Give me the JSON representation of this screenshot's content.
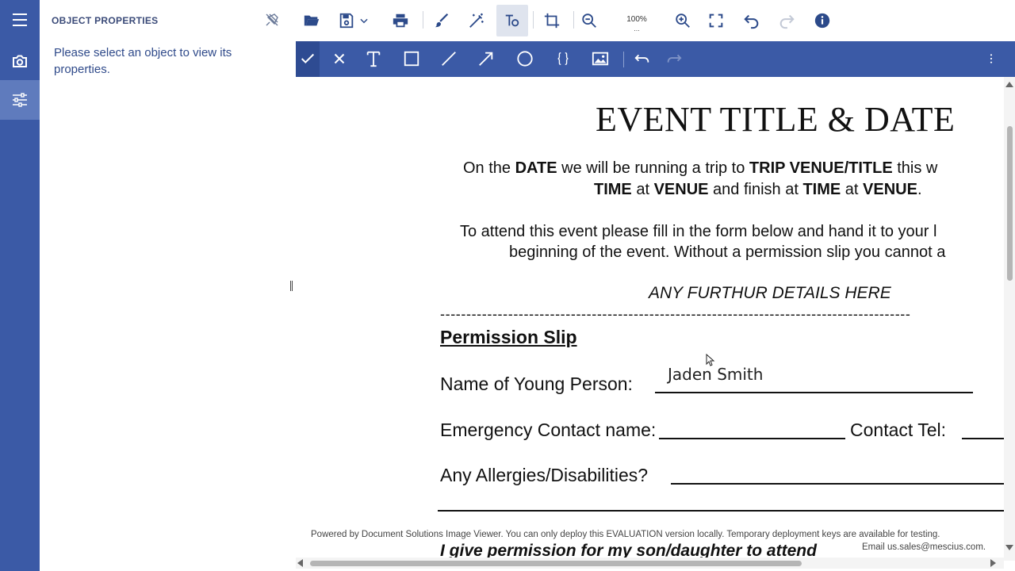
{
  "panel": {
    "title": "OBJECT PROPERTIES",
    "message": "Please select an object to view its properties."
  },
  "toolbar": {
    "zoom_value": "100%",
    "zoom_menu": "...",
    "accent_color": "#3b5aa6",
    "icons": [
      "folder-open-icon",
      "save-icon",
      "chevron-down-icon",
      "print-icon",
      "brush-icon",
      "magic-wand-icon",
      "text-tool-icon",
      "crop-icon",
      "zoom-out-icon",
      "zoom-in-icon",
      "fullscreen-icon",
      "undo-icon",
      "redo-icon",
      "info-icon"
    ]
  },
  "annotation_toolbar": {
    "icons": [
      "check-icon",
      "close-icon",
      "text-icon",
      "rectangle-icon",
      "line-icon",
      "arrow-icon",
      "ellipse-icon",
      "brackets-icon",
      "image-icon",
      "undo-icon",
      "redo-icon",
      "more-vertical-icon"
    ]
  },
  "rail": {
    "icons": [
      "menu-icon",
      "camera-icon",
      "sliders-icon"
    ]
  },
  "document": {
    "title": "EVENT TITLE & DATE",
    "p1": {
      "a": "On the ",
      "b": "DATE",
      "c": " we will be running a trip to ",
      "d": "TRIP VENUE/TITLE",
      "e": " this w",
      "f": "TIME",
      "g": " at ",
      "h": "VENUE",
      "i": " and finish at ",
      "j": "TIME",
      "k": " at ",
      "l": "VENUE",
      "m": "."
    },
    "p2_line1": "To attend this event please fill in the form below and hand it to your l",
    "p2_line2": "beginning of the event. Without a permission slip you cannot a",
    "details": "ANY FURTHUR DETAILS HERE",
    "separator": "------------------------------------------------------------------------------------------",
    "slip_title": "Permission Slip",
    "name_label": "Name of Young Person:",
    "name_value": "Jaden Smith",
    "emergency_label": "Emergency Contact name:",
    "contact_tel_label": "Contact Tel:",
    "allergies_label": "Any Allergies/Disabilities?",
    "permission_line": "I give permission for my son/daughter to attend",
    "footer_line1": "Powered by Document Solutions Image Viewer. You can only deploy this EVALUATION version locally. Temporary deployment keys are available for testing.",
    "footer_line2": "Email us.sales@mescius.com."
  }
}
